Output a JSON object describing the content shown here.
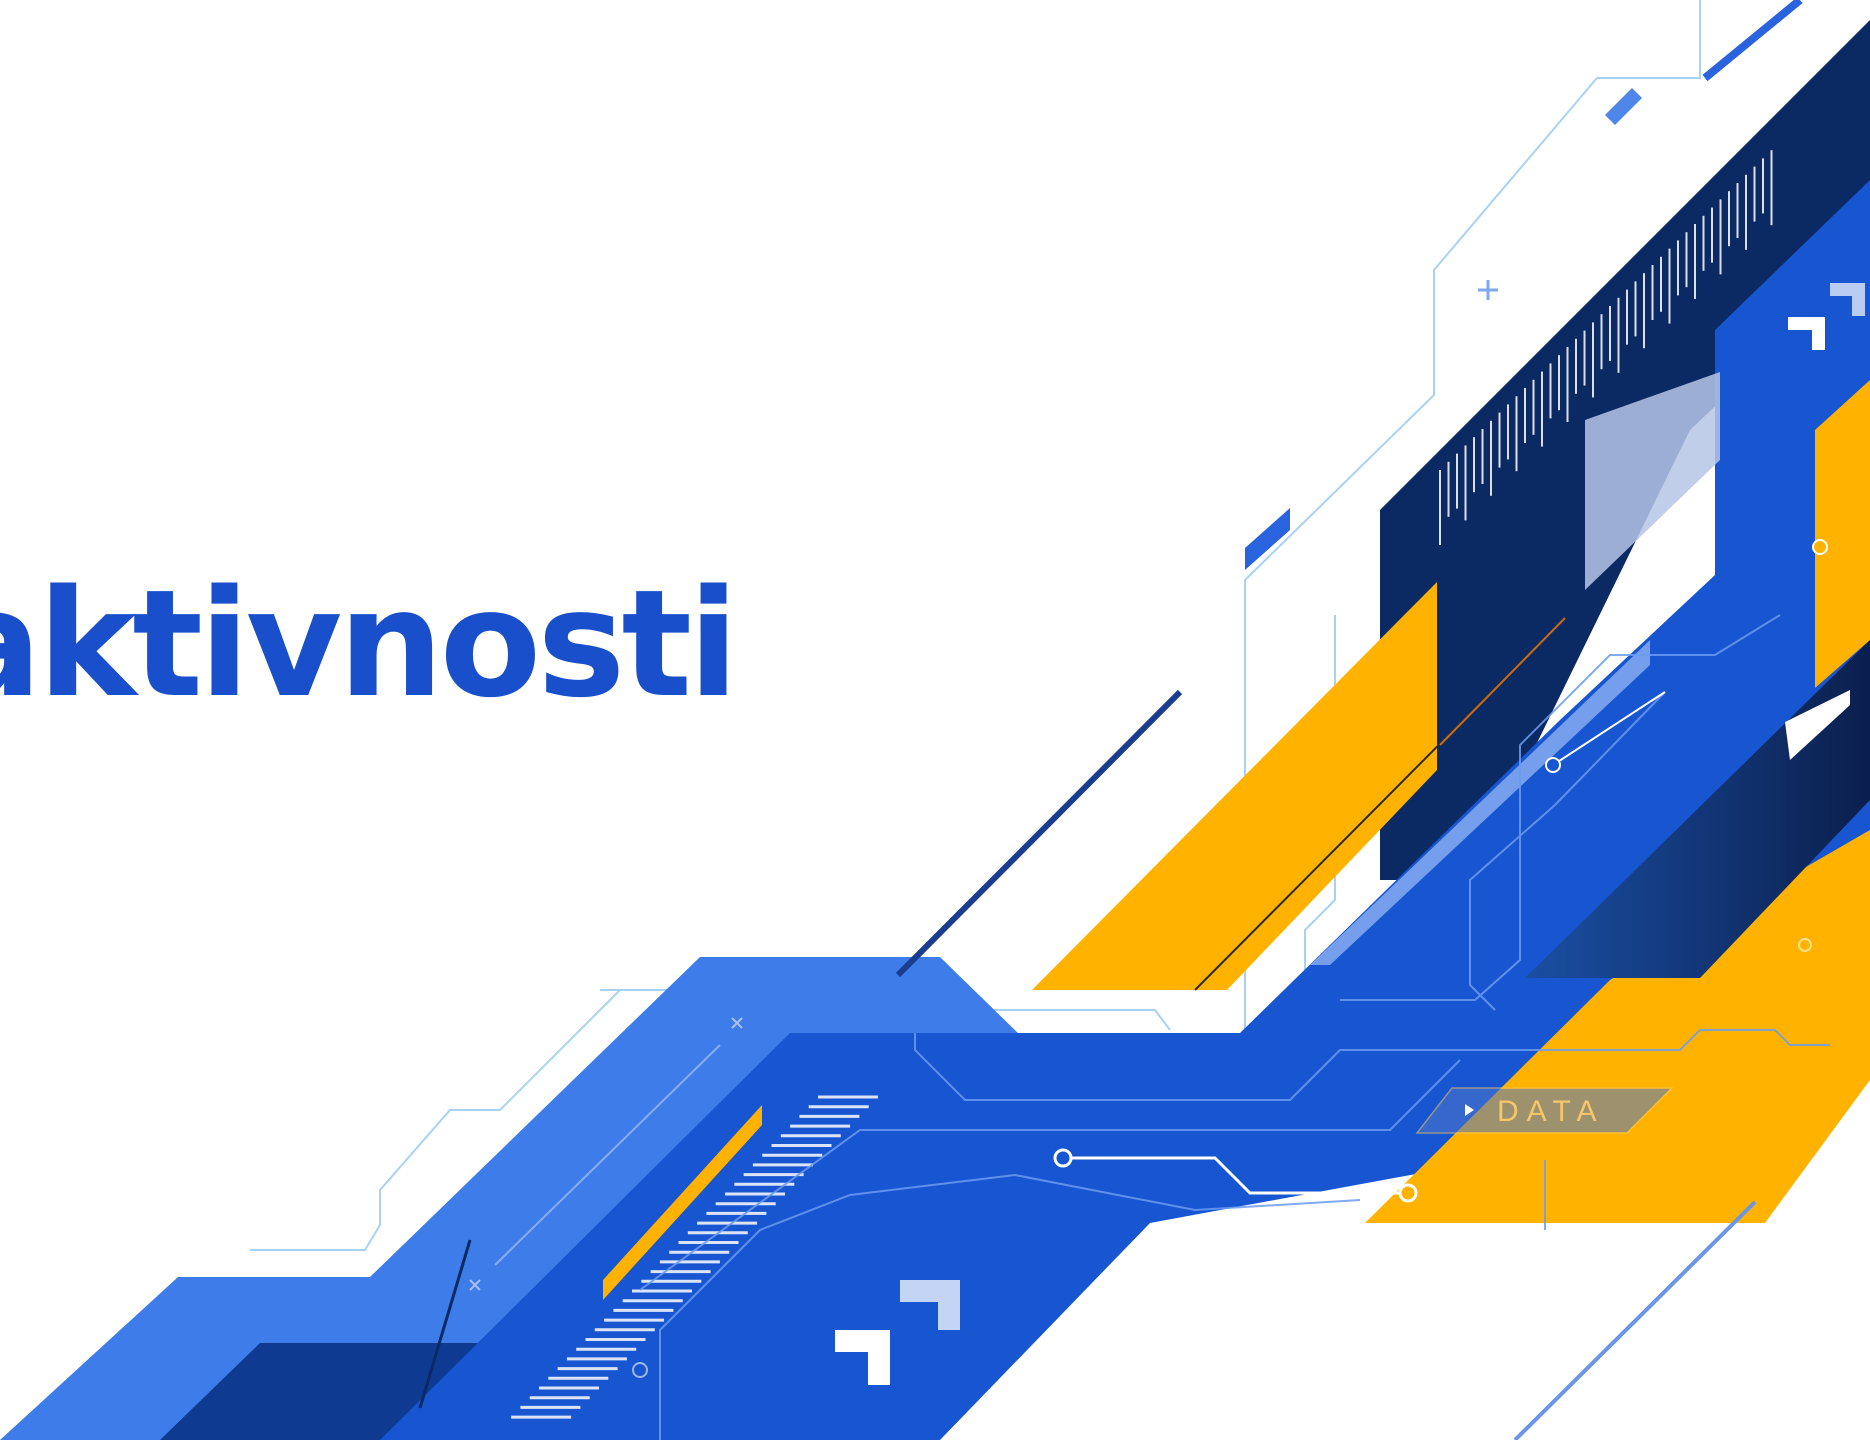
{
  "slide": {
    "title": "aktivnosti",
    "data_tag": "DATA",
    "colors": {
      "title": "#1a4fcb",
      "blue": "#1755d1",
      "light_blue": "#3e7cea",
      "navy": "#0b2a63",
      "yellow": "#ffb300"
    }
  }
}
